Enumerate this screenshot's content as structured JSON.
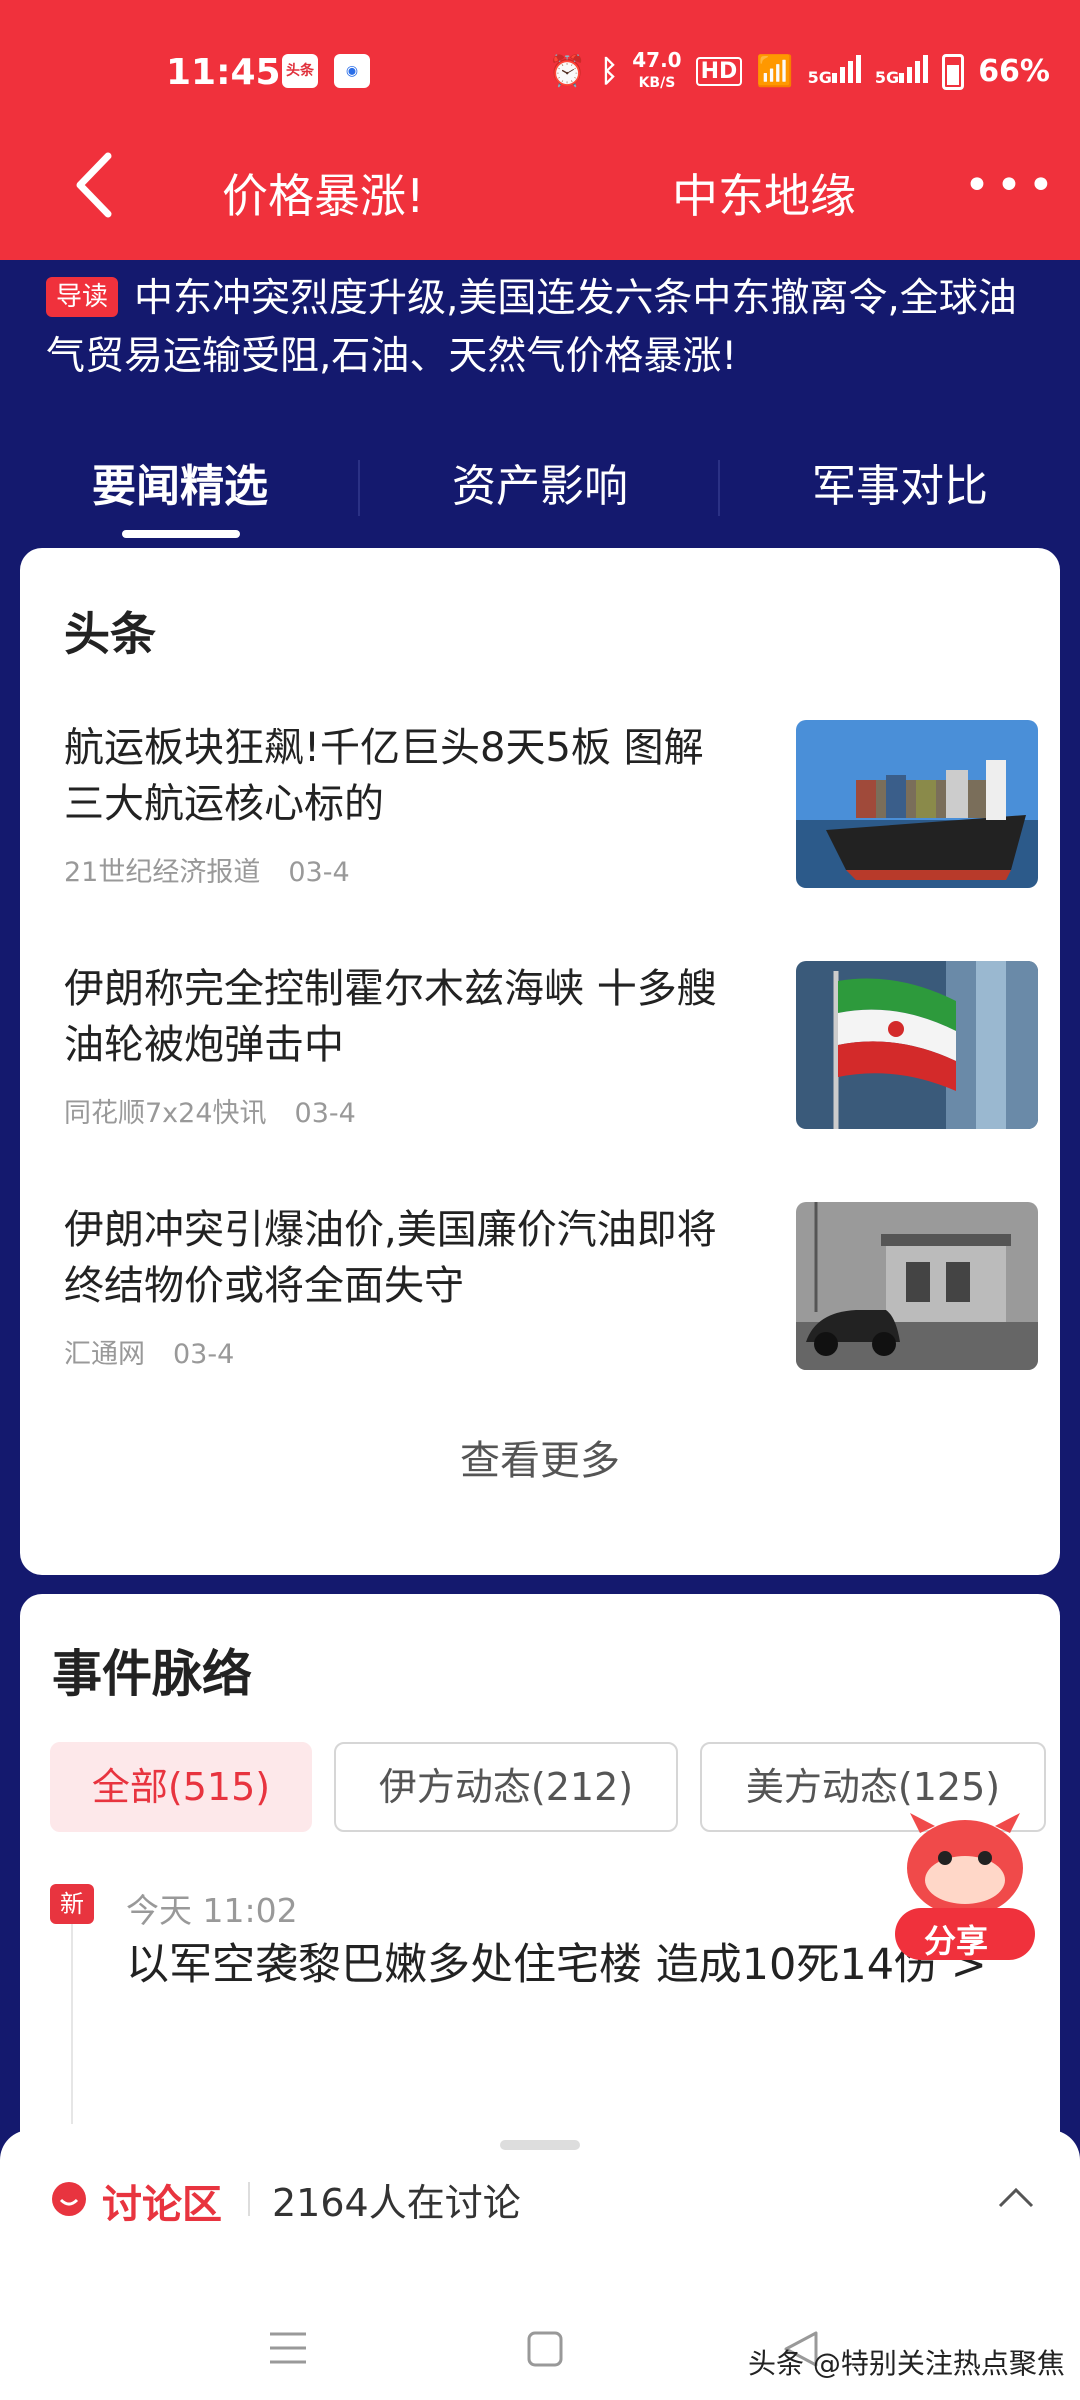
{
  "status": {
    "time": "11:45",
    "app_icon_1": "头条",
    "net_speed": "47.0",
    "net_unit": "KB/S",
    "hd": "HD",
    "sig1": "5G",
    "sig2": "5G",
    "battery": "66%"
  },
  "header": {
    "left_title": "价格暴涨!",
    "right_title": "中东地缘"
  },
  "lead": {
    "tag": "导读",
    "text": "中东冲突烈度升级,美国连发六条中东撤离令,全球油气贸易运输受阻,石油、天然气价格暴涨!"
  },
  "tabs": [
    "要闻精选",
    "资产影响",
    "军事对比"
  ],
  "headlines": {
    "title": "头条",
    "items": [
      {
        "title": "航运板块狂飙!千亿巨头8天5板 图解三大航运核心标的",
        "source": "21世纪经济报道",
        "date": "03-4"
      },
      {
        "title": "伊朗称完全控制霍尔木兹海峡 十多艘油轮被炮弹击中",
        "source": "同花顺7x24快讯",
        "date": "03-4"
      },
      {
        "title": "伊朗冲突引爆油价,美国廉价汽油即将终结物价或将全面失守",
        "source": "汇通网",
        "date": "03-4"
      }
    ],
    "more": "查看更多"
  },
  "events": {
    "title": "事件脉络",
    "filters": [
      "全部(515)",
      "伊方动态(212)",
      "美方动态(125)"
    ],
    "new_tag": "新",
    "item_time": "今天 11:02",
    "item_title": "以军空袭黎巴嫩多处住宅楼 造成10死14伤 >"
  },
  "share": "分享",
  "discussion": {
    "label": "讨论区",
    "count": "2164人在讨论"
  },
  "watermark": "头条 @特别关注热点聚焦",
  "colors": {
    "red": "#f0313c",
    "navy": "#14196e"
  }
}
